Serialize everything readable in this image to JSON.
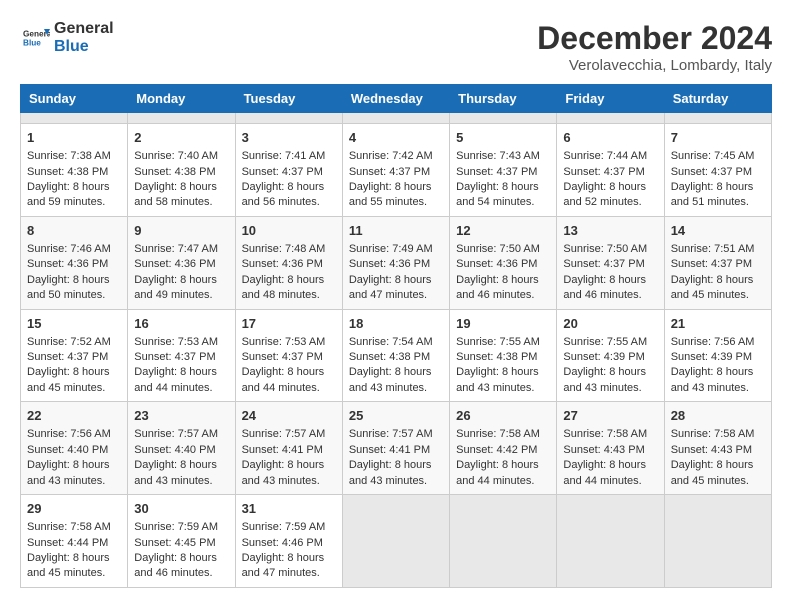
{
  "header": {
    "logo_line1": "General",
    "logo_line2": "Blue",
    "title": "December 2024",
    "subtitle": "Verolavecchia, Lombardy, Italy"
  },
  "calendar": {
    "days_of_week": [
      "Sunday",
      "Monday",
      "Tuesday",
      "Wednesday",
      "Thursday",
      "Friday",
      "Saturday"
    ],
    "weeks": [
      [
        {
          "day": "",
          "empty": true
        },
        {
          "day": "",
          "empty": true
        },
        {
          "day": "",
          "empty": true
        },
        {
          "day": "",
          "empty": true
        },
        {
          "day": "",
          "empty": true
        },
        {
          "day": "",
          "empty": true
        },
        {
          "day": "",
          "empty": true
        }
      ],
      [
        {
          "day": "1",
          "sunrise": "Sunrise: 7:38 AM",
          "sunset": "Sunset: 4:38 PM",
          "daylight": "Daylight: 8 hours and 59 minutes."
        },
        {
          "day": "2",
          "sunrise": "Sunrise: 7:40 AM",
          "sunset": "Sunset: 4:38 PM",
          "daylight": "Daylight: 8 hours and 58 minutes."
        },
        {
          "day": "3",
          "sunrise": "Sunrise: 7:41 AM",
          "sunset": "Sunset: 4:37 PM",
          "daylight": "Daylight: 8 hours and 56 minutes."
        },
        {
          "day": "4",
          "sunrise": "Sunrise: 7:42 AM",
          "sunset": "Sunset: 4:37 PM",
          "daylight": "Daylight: 8 hours and 55 minutes."
        },
        {
          "day": "5",
          "sunrise": "Sunrise: 7:43 AM",
          "sunset": "Sunset: 4:37 PM",
          "daylight": "Daylight: 8 hours and 54 minutes."
        },
        {
          "day": "6",
          "sunrise": "Sunrise: 7:44 AM",
          "sunset": "Sunset: 4:37 PM",
          "daylight": "Daylight: 8 hours and 52 minutes."
        },
        {
          "day": "7",
          "sunrise": "Sunrise: 7:45 AM",
          "sunset": "Sunset: 4:37 PM",
          "daylight": "Daylight: 8 hours and 51 minutes."
        }
      ],
      [
        {
          "day": "8",
          "sunrise": "Sunrise: 7:46 AM",
          "sunset": "Sunset: 4:36 PM",
          "daylight": "Daylight: 8 hours and 50 minutes."
        },
        {
          "day": "9",
          "sunrise": "Sunrise: 7:47 AM",
          "sunset": "Sunset: 4:36 PM",
          "daylight": "Daylight: 8 hours and 49 minutes."
        },
        {
          "day": "10",
          "sunrise": "Sunrise: 7:48 AM",
          "sunset": "Sunset: 4:36 PM",
          "daylight": "Daylight: 8 hours and 48 minutes."
        },
        {
          "day": "11",
          "sunrise": "Sunrise: 7:49 AM",
          "sunset": "Sunset: 4:36 PM",
          "daylight": "Daylight: 8 hours and 47 minutes."
        },
        {
          "day": "12",
          "sunrise": "Sunrise: 7:50 AM",
          "sunset": "Sunset: 4:36 PM",
          "daylight": "Daylight: 8 hours and 46 minutes."
        },
        {
          "day": "13",
          "sunrise": "Sunrise: 7:50 AM",
          "sunset": "Sunset: 4:37 PM",
          "daylight": "Daylight: 8 hours and 46 minutes."
        },
        {
          "day": "14",
          "sunrise": "Sunrise: 7:51 AM",
          "sunset": "Sunset: 4:37 PM",
          "daylight": "Daylight: 8 hours and 45 minutes."
        }
      ],
      [
        {
          "day": "15",
          "sunrise": "Sunrise: 7:52 AM",
          "sunset": "Sunset: 4:37 PM",
          "daylight": "Daylight: 8 hours and 45 minutes."
        },
        {
          "day": "16",
          "sunrise": "Sunrise: 7:53 AM",
          "sunset": "Sunset: 4:37 PM",
          "daylight": "Daylight: 8 hours and 44 minutes."
        },
        {
          "day": "17",
          "sunrise": "Sunrise: 7:53 AM",
          "sunset": "Sunset: 4:37 PM",
          "daylight": "Daylight: 8 hours and 44 minutes."
        },
        {
          "day": "18",
          "sunrise": "Sunrise: 7:54 AM",
          "sunset": "Sunset: 4:38 PM",
          "daylight": "Daylight: 8 hours and 43 minutes."
        },
        {
          "day": "19",
          "sunrise": "Sunrise: 7:55 AM",
          "sunset": "Sunset: 4:38 PM",
          "daylight": "Daylight: 8 hours and 43 minutes."
        },
        {
          "day": "20",
          "sunrise": "Sunrise: 7:55 AM",
          "sunset": "Sunset: 4:39 PM",
          "daylight": "Daylight: 8 hours and 43 minutes."
        },
        {
          "day": "21",
          "sunrise": "Sunrise: 7:56 AM",
          "sunset": "Sunset: 4:39 PM",
          "daylight": "Daylight: 8 hours and 43 minutes."
        }
      ],
      [
        {
          "day": "22",
          "sunrise": "Sunrise: 7:56 AM",
          "sunset": "Sunset: 4:40 PM",
          "daylight": "Daylight: 8 hours and 43 minutes."
        },
        {
          "day": "23",
          "sunrise": "Sunrise: 7:57 AM",
          "sunset": "Sunset: 4:40 PM",
          "daylight": "Daylight: 8 hours and 43 minutes."
        },
        {
          "day": "24",
          "sunrise": "Sunrise: 7:57 AM",
          "sunset": "Sunset: 4:41 PM",
          "daylight": "Daylight: 8 hours and 43 minutes."
        },
        {
          "day": "25",
          "sunrise": "Sunrise: 7:57 AM",
          "sunset": "Sunset: 4:41 PM",
          "daylight": "Daylight: 8 hours and 43 minutes."
        },
        {
          "day": "26",
          "sunrise": "Sunrise: 7:58 AM",
          "sunset": "Sunset: 4:42 PM",
          "daylight": "Daylight: 8 hours and 44 minutes."
        },
        {
          "day": "27",
          "sunrise": "Sunrise: 7:58 AM",
          "sunset": "Sunset: 4:43 PM",
          "daylight": "Daylight: 8 hours and 44 minutes."
        },
        {
          "day": "28",
          "sunrise": "Sunrise: 7:58 AM",
          "sunset": "Sunset: 4:43 PM",
          "daylight": "Daylight: 8 hours and 45 minutes."
        }
      ],
      [
        {
          "day": "29",
          "sunrise": "Sunrise: 7:58 AM",
          "sunset": "Sunset: 4:44 PM",
          "daylight": "Daylight: 8 hours and 45 minutes."
        },
        {
          "day": "30",
          "sunrise": "Sunrise: 7:59 AM",
          "sunset": "Sunset: 4:45 PM",
          "daylight": "Daylight: 8 hours and 46 minutes."
        },
        {
          "day": "31",
          "sunrise": "Sunrise: 7:59 AM",
          "sunset": "Sunset: 4:46 PM",
          "daylight": "Daylight: 8 hours and 47 minutes."
        },
        {
          "day": "",
          "empty": true
        },
        {
          "day": "",
          "empty": true
        },
        {
          "day": "",
          "empty": true
        },
        {
          "day": "",
          "empty": true
        }
      ]
    ]
  }
}
